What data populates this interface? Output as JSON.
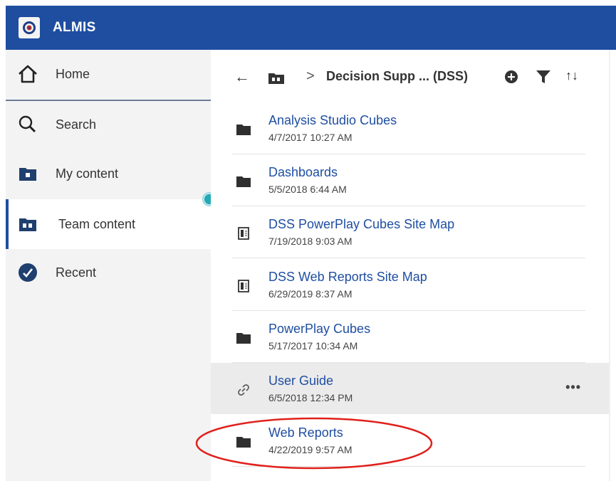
{
  "app": {
    "title": "ALMIS"
  },
  "sidebar": {
    "items": [
      {
        "label": "Home",
        "icon": "home-icon"
      },
      {
        "label": "Search",
        "icon": "search-icon"
      },
      {
        "label": "My content",
        "icon": "my-content-icon"
      },
      {
        "label": "Team content",
        "icon": "team-content-icon",
        "selected": true
      },
      {
        "label": "Recent",
        "icon": "recent-icon"
      }
    ]
  },
  "breadcrumb": {
    "current": "Decision Supp ... (DSS)",
    "separator": ">"
  },
  "list": [
    {
      "name": "Analysis Studio Cubes",
      "date": "4/7/2017 10:27 AM",
      "type": "folder"
    },
    {
      "name": "Dashboards",
      "date": "5/5/2018 6:44 AM",
      "type": "folder"
    },
    {
      "name": "DSS PowerPlay Cubes Site Map",
      "date": "7/19/2018 9:03 AM",
      "type": "report"
    },
    {
      "name": "DSS Web Reports Site Map",
      "date": "6/29/2019 8:37 AM",
      "type": "report"
    },
    {
      "name": "PowerPlay Cubes",
      "date": "5/17/2017 10:34 AM",
      "type": "folder"
    },
    {
      "name": "User Guide",
      "date": "6/5/2018 12:34 PM",
      "type": "link",
      "hovered": true
    },
    {
      "name": "Web Reports",
      "date": "4/22/2019 9:57 AM",
      "type": "folder",
      "annotated": true
    }
  ],
  "colors": {
    "brand": "#1f4ea1",
    "annotation": "#e0201b",
    "accent_dot": "#23a8b5"
  }
}
